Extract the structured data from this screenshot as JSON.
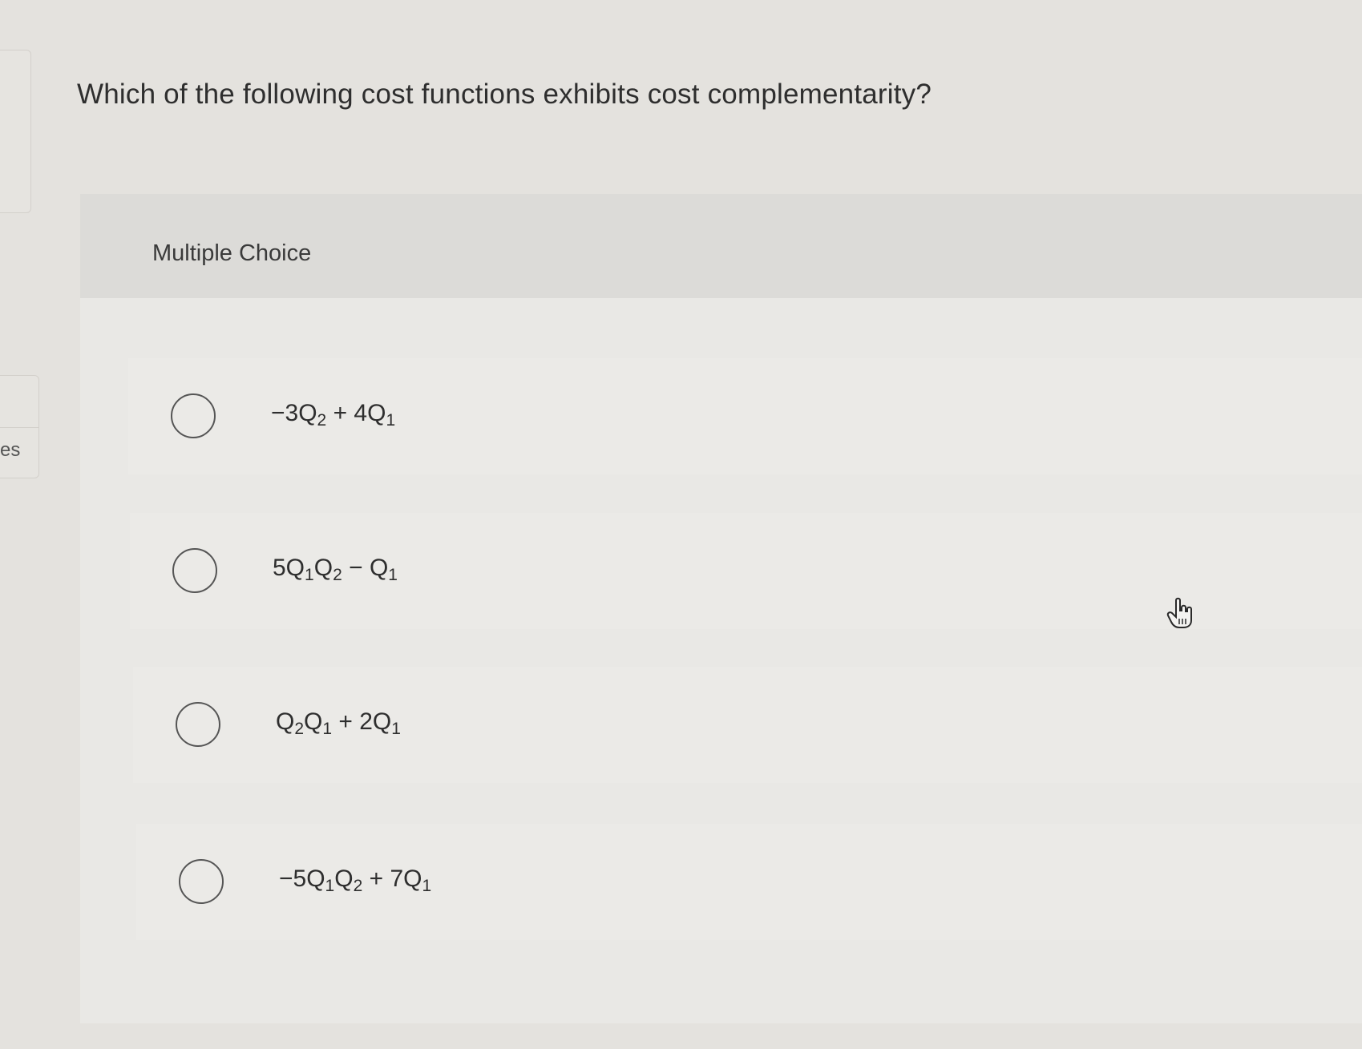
{
  "sidebar": {
    "tab_label": "es"
  },
  "question": {
    "text": "Which of the following cost functions exhibits cost complementarity?"
  },
  "choices": {
    "header": "Multiple Choice",
    "options": [
      {
        "selected": false,
        "parts": [
          "−3Q",
          "2",
          " + 4Q",
          "1"
        ]
      },
      {
        "selected": false,
        "parts": [
          "5Q",
          "1",
          "Q",
          "2",
          " − Q",
          "1"
        ]
      },
      {
        "selected": false,
        "parts": [
          "Q",
          "2",
          "Q",
          "1",
          " + 2Q",
          "1"
        ]
      },
      {
        "selected": false,
        "parts": [
          "−5Q",
          "1",
          "Q",
          "2",
          " + 7Q",
          "1"
        ]
      }
    ]
  },
  "cursor": {
    "icon": "hand-pointer-icon"
  }
}
